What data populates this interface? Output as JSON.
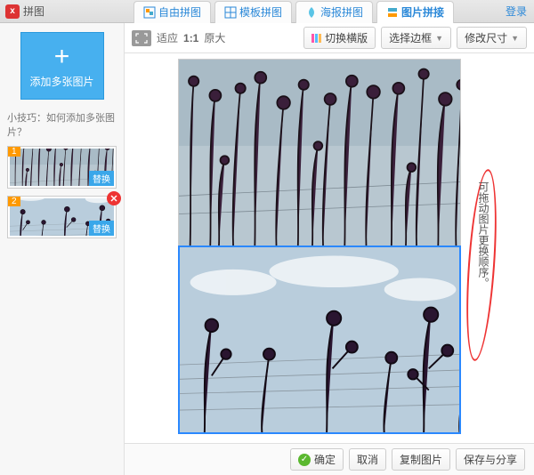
{
  "app": {
    "title": "拼图",
    "login": "登录"
  },
  "tabs": [
    {
      "label": "自由拼图",
      "active": false
    },
    {
      "label": "模板拼图",
      "active": false
    },
    {
      "label": "海报拼图",
      "active": false
    },
    {
      "label": "图片拼接",
      "active": true
    }
  ],
  "sidebar": {
    "add_label": "添加多张图片",
    "tip": "小技巧：如何添加多张图片？",
    "replace_label": "替换",
    "thumbs": [
      {
        "num": "1"
      },
      {
        "num": "2"
      }
    ]
  },
  "toolbar": {
    "fit_label": "适应",
    "ratio": "1:1",
    "orig": "原大",
    "layout_label": "切换横版",
    "border_label": "选择边框",
    "size_label": "修改尺寸"
  },
  "annotation": "可拖动图片更换顺序。",
  "footer": {
    "ok": "确定",
    "cancel": "取消",
    "copy": "复制图片",
    "save": "保存与分享"
  },
  "colors": {
    "accent": "#2a88d8",
    "add_btn": "#47b0ef",
    "num_badge": "#f90",
    "del": "#e33",
    "ok": "#5ab82f"
  }
}
